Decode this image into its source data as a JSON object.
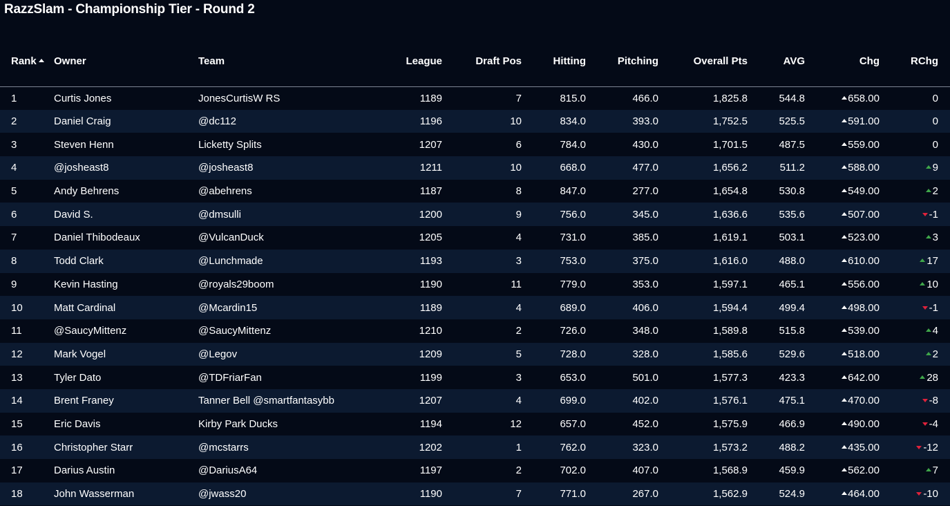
{
  "page_title": "RazzSlam - Championship Tier - Round 2",
  "colors": {
    "background": "#040a17",
    "row_alt": "#0c1a30",
    "up": "#3fa64a",
    "down": "#e0223b"
  },
  "columns": [
    "Rank",
    "Owner",
    "Team",
    "League",
    "Draft Pos",
    "Hitting",
    "Pitching",
    "Overall Pts",
    "AVG",
    "Chg",
    "RChg"
  ],
  "sort": {
    "column": "Rank",
    "direction": "ascending"
  },
  "rows": [
    {
      "rank": "1",
      "owner": "Curtis Jones",
      "team": "JonesCurtisW RS",
      "league": "1189",
      "draft_pos": "7",
      "hitting": "815.0",
      "pitching": "466.0",
      "overall": "1,825.8",
      "avg": "544.8",
      "chg": "658.00",
      "rchg": "0",
      "rchg_dir": "none"
    },
    {
      "rank": "2",
      "owner": "Daniel Craig",
      "team": "@dc112",
      "league": "1196",
      "draft_pos": "10",
      "hitting": "834.0",
      "pitching": "393.0",
      "overall": "1,752.5",
      "avg": "525.5",
      "chg": "591.00",
      "rchg": "0",
      "rchg_dir": "none"
    },
    {
      "rank": "3",
      "owner": "Steven Henn",
      "team": "Licketty Splits",
      "league": "1207",
      "draft_pos": "6",
      "hitting": "784.0",
      "pitching": "430.0",
      "overall": "1,701.5",
      "avg": "487.5",
      "chg": "559.00",
      "rchg": "0",
      "rchg_dir": "none"
    },
    {
      "rank": "4",
      "owner": "@josheast8",
      "team": "@josheast8",
      "league": "1211",
      "draft_pos": "10",
      "hitting": "668.0",
      "pitching": "477.0",
      "overall": "1,656.2",
      "avg": "511.2",
      "chg": "588.00",
      "rchg": "9",
      "rchg_dir": "up"
    },
    {
      "rank": "5",
      "owner": "Andy Behrens",
      "team": "@abehrens",
      "league": "1187",
      "draft_pos": "8",
      "hitting": "847.0",
      "pitching": "277.0",
      "overall": "1,654.8",
      "avg": "530.8",
      "chg": "549.00",
      "rchg": "2",
      "rchg_dir": "up"
    },
    {
      "rank": "6",
      "owner": "David S.",
      "team": "@dmsulli",
      "league": "1200",
      "draft_pos": "9",
      "hitting": "756.0",
      "pitching": "345.0",
      "overall": "1,636.6",
      "avg": "535.6",
      "chg": "507.00",
      "rchg": "-1",
      "rchg_dir": "down"
    },
    {
      "rank": "7",
      "owner": "Daniel Thibodeaux",
      "team": "@VulcanDuck",
      "league": "1205",
      "draft_pos": "4",
      "hitting": "731.0",
      "pitching": "385.0",
      "overall": "1,619.1",
      "avg": "503.1",
      "chg": "523.00",
      "rchg": "3",
      "rchg_dir": "up"
    },
    {
      "rank": "8",
      "owner": "Todd Clark",
      "team": "@Lunchmade",
      "league": "1193",
      "draft_pos": "3",
      "hitting": "753.0",
      "pitching": "375.0",
      "overall": "1,616.0",
      "avg": "488.0",
      "chg": "610.00",
      "rchg": "17",
      "rchg_dir": "up"
    },
    {
      "rank": "9",
      "owner": "Kevin Hasting",
      "team": "@royals29boom",
      "league": "1190",
      "draft_pos": "11",
      "hitting": "779.0",
      "pitching": "353.0",
      "overall": "1,597.1",
      "avg": "465.1",
      "chg": "556.00",
      "rchg": "10",
      "rchg_dir": "up"
    },
    {
      "rank": "10",
      "owner": "Matt Cardinal",
      "team": "@Mcardin15",
      "league": "1189",
      "draft_pos": "4",
      "hitting": "689.0",
      "pitching": "406.0",
      "overall": "1,594.4",
      "avg": "499.4",
      "chg": "498.00",
      "rchg": "-1",
      "rchg_dir": "down"
    },
    {
      "rank": "11",
      "owner": "@SaucyMittenz",
      "team": "@SaucyMittenz",
      "league": "1210",
      "draft_pos": "2",
      "hitting": "726.0",
      "pitching": "348.0",
      "overall": "1,589.8",
      "avg": "515.8",
      "chg": "539.00",
      "rchg": "4",
      "rchg_dir": "up"
    },
    {
      "rank": "12",
      "owner": "Mark Vogel",
      "team": "@Legov",
      "league": "1209",
      "draft_pos": "5",
      "hitting": "728.0",
      "pitching": "328.0",
      "overall": "1,585.6",
      "avg": "529.6",
      "chg": "518.00",
      "rchg": "2",
      "rchg_dir": "up"
    },
    {
      "rank": "13",
      "owner": "Tyler Dato",
      "team": "@TDFriarFan",
      "league": "1199",
      "draft_pos": "3",
      "hitting": "653.0",
      "pitching": "501.0",
      "overall": "1,577.3",
      "avg": "423.3",
      "chg": "642.00",
      "rchg": "28",
      "rchg_dir": "up"
    },
    {
      "rank": "14",
      "owner": "Brent Franey",
      "team": "Tanner Bell @smartfantasybb",
      "league": "1207",
      "draft_pos": "4",
      "hitting": "699.0",
      "pitching": "402.0",
      "overall": "1,576.1",
      "avg": "475.1",
      "chg": "470.00",
      "rchg": "-8",
      "rchg_dir": "down"
    },
    {
      "rank": "15",
      "owner": "Eric Davis",
      "team": "Kirby Park Ducks",
      "league": "1194",
      "draft_pos": "12",
      "hitting": "657.0",
      "pitching": "452.0",
      "overall": "1,575.9",
      "avg": "466.9",
      "chg": "490.00",
      "rchg": "-4",
      "rchg_dir": "down"
    },
    {
      "rank": "16",
      "owner": "Christopher Starr",
      "team": "@mcstarrs",
      "league": "1202",
      "draft_pos": "1",
      "hitting": "762.0",
      "pitching": "323.0",
      "overall": "1,573.2",
      "avg": "488.2",
      "chg": "435.00",
      "rchg": "-12",
      "rchg_dir": "down"
    },
    {
      "rank": "17",
      "owner": "Darius Austin",
      "team": "@DariusA64",
      "league": "1197",
      "draft_pos": "2",
      "hitting": "702.0",
      "pitching": "407.0",
      "overall": "1,568.9",
      "avg": "459.9",
      "chg": "562.00",
      "rchg": "7",
      "rchg_dir": "up"
    },
    {
      "rank": "18",
      "owner": "John Wasserman",
      "team": "@jwass20",
      "league": "1190",
      "draft_pos": "7",
      "hitting": "771.0",
      "pitching": "267.0",
      "overall": "1,562.9",
      "avg": "524.9",
      "chg": "464.00",
      "rchg": "-10",
      "rchg_dir": "down"
    }
  ]
}
